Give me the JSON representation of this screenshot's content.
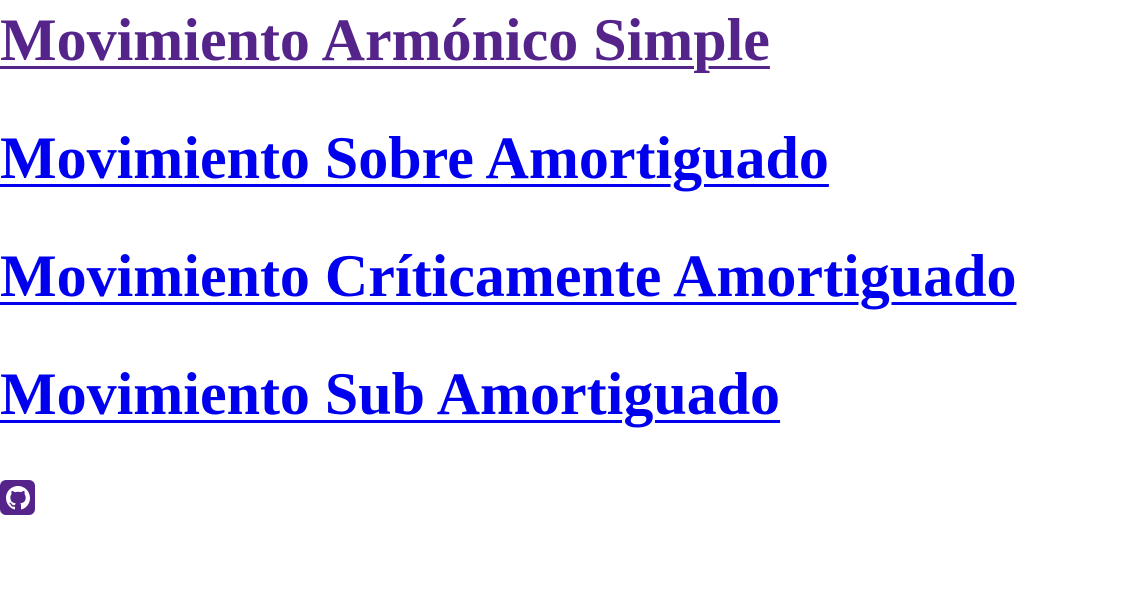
{
  "links": [
    {
      "label": "Movimiento Armónico Simple",
      "state": "visited"
    },
    {
      "label": "Movimiento Sobre Amortiguado",
      "state": "unvisited"
    },
    {
      "label": "Movimiento Críticamente Amortiguado",
      "state": "unvisited"
    },
    {
      "label": "Movimiento Sub Amortiguado",
      "state": "unvisited"
    }
  ],
  "footer": {
    "icon": "github-icon"
  },
  "colors": {
    "visited_link": "#55248b",
    "unvisited_link": "#0000ee",
    "background": "#ffffff"
  }
}
